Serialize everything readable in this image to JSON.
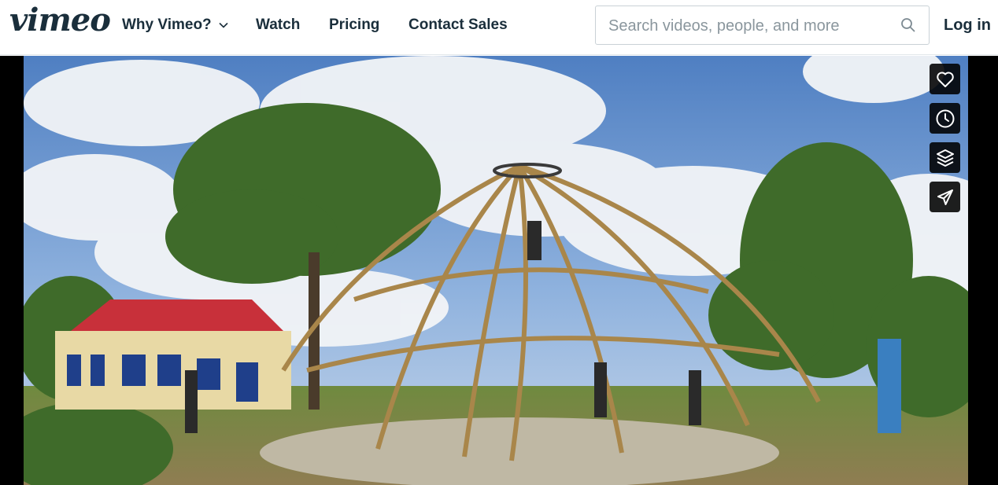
{
  "brand": {
    "logo_text": "vimeo"
  },
  "nav": {
    "why": "Why Vimeo?",
    "watch": "Watch",
    "pricing": "Pricing",
    "contact": "Contact Sales"
  },
  "search": {
    "placeholder": "Search videos, people, and more",
    "value": ""
  },
  "auth": {
    "login": "Log in"
  },
  "player": {
    "side_actions": [
      {
        "icon": "heart-icon"
      },
      {
        "icon": "clock-icon"
      },
      {
        "icon": "layers-icon"
      },
      {
        "icon": "paper-plane-icon"
      }
    ]
  },
  "colors": {
    "text": "#1a2e3b",
    "player_bg": "#000000",
    "action_bg": "#000000"
  }
}
